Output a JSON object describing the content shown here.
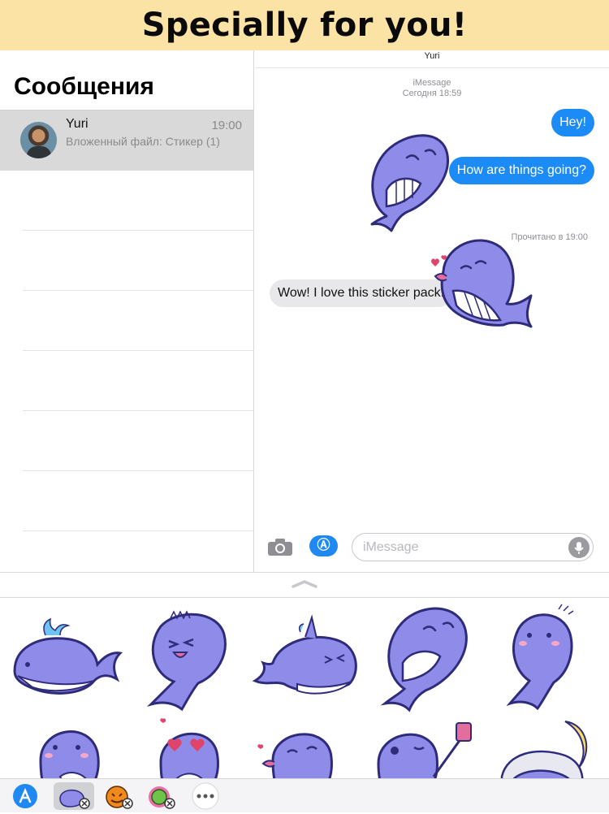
{
  "banner": {
    "title": "Specially for you!"
  },
  "sidebar": {
    "title": "Сообщения",
    "conversations": [
      {
        "name": "Yuri",
        "time": "19:00",
        "preview": "Вложенный файл: Стикер (1)"
      }
    ]
  },
  "chat": {
    "contact": "Yuri",
    "service": "iMessage",
    "date": "Сегодня 18:59",
    "messages": [
      {
        "direction": "out",
        "text": "Hey!"
      },
      {
        "direction": "out",
        "text": "How are things going?"
      },
      {
        "direction": "in",
        "text": "Wow! I love this sticker pack!"
      }
    ],
    "read_receipt": "Прочитано в 19:00"
  },
  "composer": {
    "placeholder": "iMessage"
  },
  "colors": {
    "accent": "#1c8bf6",
    "banner": "#fbe3a6",
    "whale": "#8f8be8",
    "whale_outline": "#2e2b7a"
  },
  "icons": {
    "camera": "camera-icon",
    "app_store": "app-store-icon",
    "mic": "microphone-icon",
    "more": "more-icon"
  }
}
